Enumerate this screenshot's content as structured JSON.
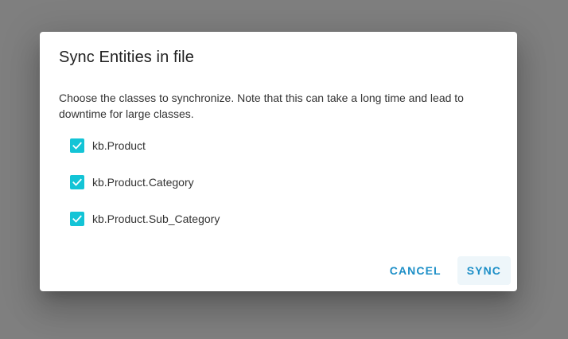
{
  "dialog": {
    "title": "Sync Entities in file",
    "description": "Choose the classes to synchronize. Note that this can take a long time and lead to downtime for large classes.",
    "options": [
      {
        "label": "kb.Product",
        "checked": true
      },
      {
        "label": "kb.Product.Category",
        "checked": true
      },
      {
        "label": "kb.Product.Sub_Category",
        "checked": true
      }
    ],
    "cancel_label": "Cancel",
    "sync_label": "Sync"
  },
  "colors": {
    "checkbox": "#13c4d6",
    "button_text": "#1d8fc7",
    "backdrop": "#7f7f7f"
  },
  "icons": {
    "checkbox": "check-icon"
  }
}
